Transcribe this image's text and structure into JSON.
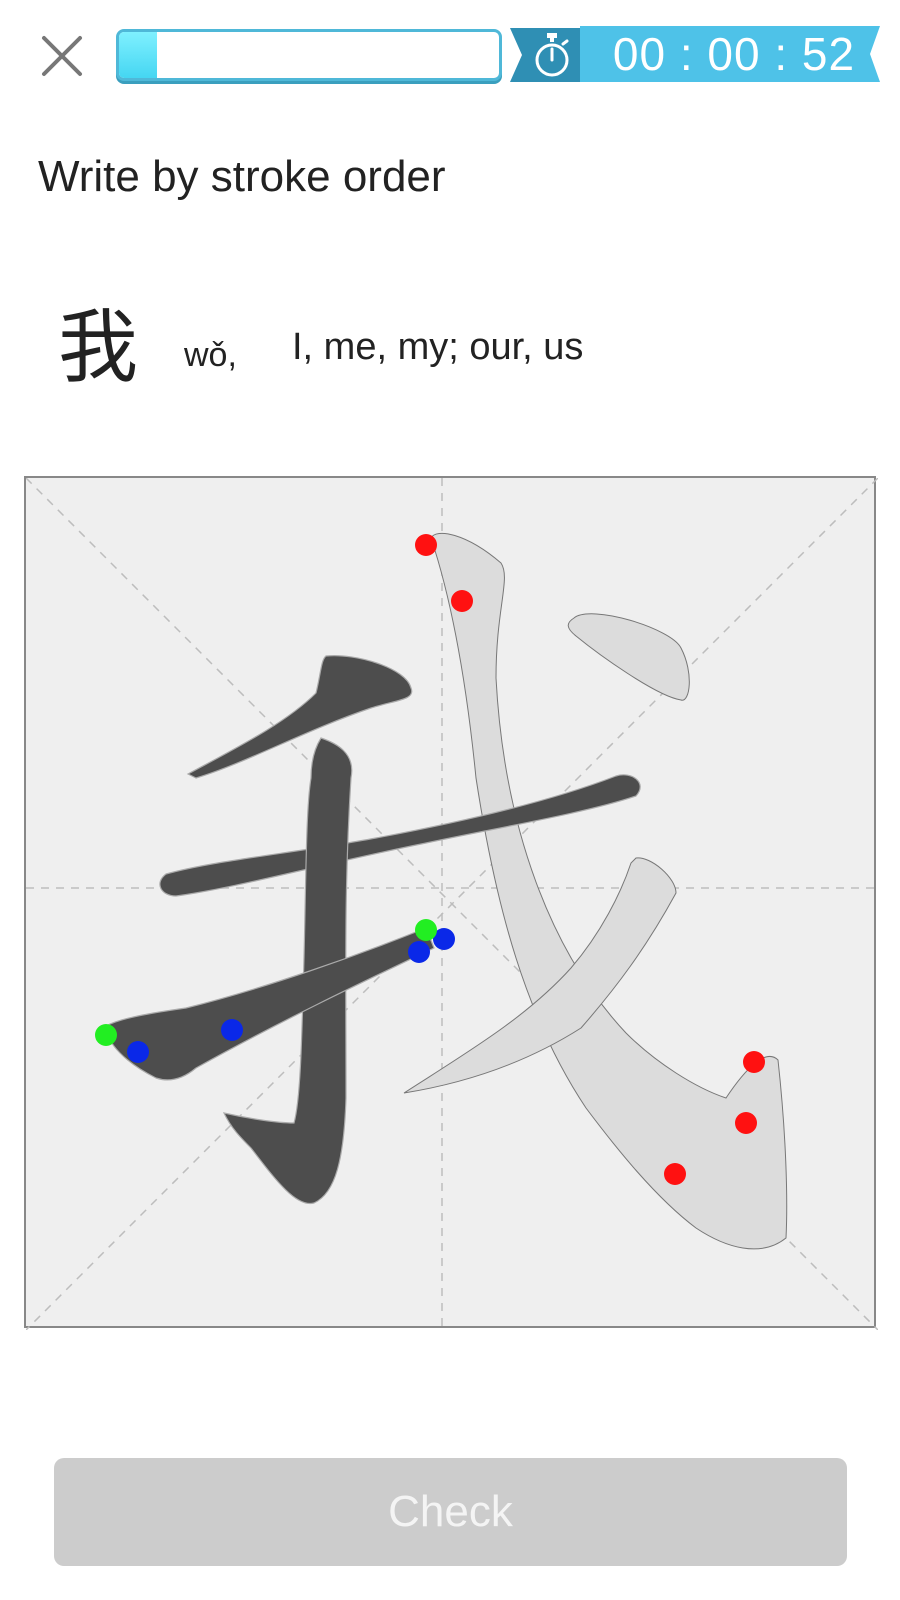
{
  "header": {
    "progress_fraction": 0.1,
    "timer_text": "00 : 00 : 52",
    "close_icon": "close-icon",
    "timer_icon": "stopwatch-icon"
  },
  "instruction": "Write by stroke order",
  "word": {
    "character": "我",
    "pinyin": "wǒ,",
    "meaning": "I, me, my; our, us"
  },
  "writing_board": {
    "strokes_total": 7,
    "strokes_completed": 3
  },
  "check_label": "Check",
  "colors": {
    "accent": "#45d6f2",
    "accent_dark": "#3a9fbe",
    "timer_bg": "#3bb0d6",
    "stroke_done": "#4d4d4d",
    "stroke_pending": "#dcdcdc",
    "hint_red": "#ff1111",
    "hint_blue": "#0a28e8",
    "hint_green": "#22ee22",
    "button_disabled": "#cccccc"
  }
}
